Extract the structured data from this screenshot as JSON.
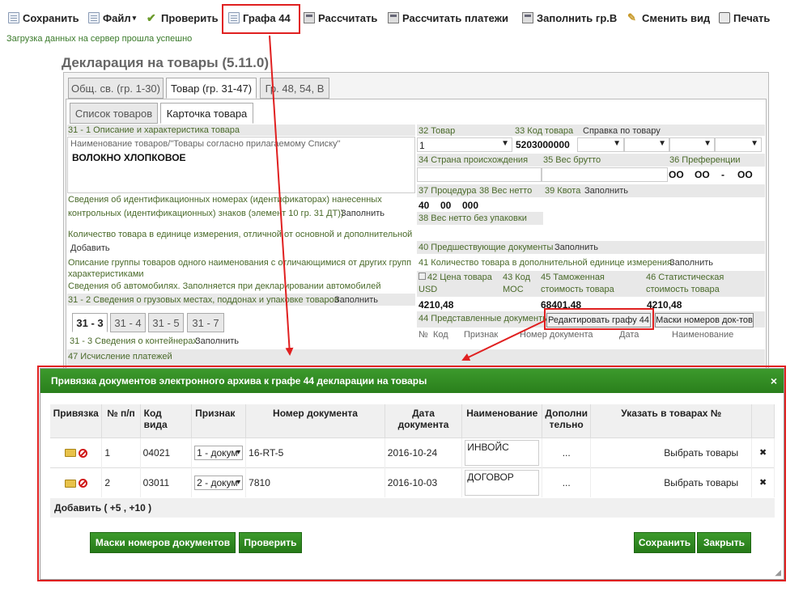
{
  "toolbar": {
    "save": "Сохранить",
    "file": "Файл",
    "check": "Проверить",
    "graph44": "Графа 44",
    "calculate": "Рассчитать",
    "calc_payments": "Рассчитать платежи",
    "fill_b": "Заполнить гр.В",
    "change_view": "Сменить вид",
    "print": "Печать"
  },
  "status_message": "Загрузка данных на сервер прошла успешно",
  "declaration_title": "Декларация на товары (5.11.0)",
  "tabs": [
    "Общ. св. (гр. 1-30)",
    "Товар (гр. 31-47)",
    "Гр. 48, 54, В"
  ],
  "subtabs": [
    "Список товаров",
    "Карточка товара"
  ],
  "left": {
    "f31_label": "31 - 1 Описание и характеристика товара",
    "f31_hint": "Наименование товаров/\"Товары согласно прилагаемому Списку\"",
    "f31_value": "ВОЛОКНО ХЛОПКОВОЕ",
    "ident_line1": "Сведения об идентификационных номерах (идентификаторах) нанесенных",
    "ident_line2": "контрольных (идентификационных) знаков (элемент 10 гр. 31 ДТ))",
    "fill": "Заполнить",
    "qty_label": "Количество товара в единице измерения, отличной от основной и дополнительной",
    "add": "Добавить",
    "group_desc_line1": "Описание группы товаров одного наименования с отличающимися от других групп",
    "group_desc_line2": "характеристиками",
    "cars": "Сведения об автомобилях. Заполняется при декларировании автомобилей",
    "f31_2": "31 - 2 Сведения о грузовых местах, поддонах и упаковке товаров",
    "subtabs31": [
      "31 - 3",
      "31 - 4",
      "31 - 5",
      "31 - 7"
    ],
    "containers": "31 - 3 Сведения о контейнерах",
    "f47": "47 Исчисление платежей"
  },
  "right": {
    "f32": "32 Товар",
    "f32_value": "1",
    "f33": "33 Код товара",
    "f33_value": "5203000000",
    "reference": "Справка по товару",
    "f34": "34 Страна происхождения",
    "f35": "35 Вес брутто",
    "f36": "36 Преференции",
    "f36_values": [
      "ОО",
      "ОО",
      "-",
      "ОО"
    ],
    "f37": "37 Процедура",
    "f37_values": [
      "40",
      "00",
      "000"
    ],
    "f38": "38 Вес нетто",
    "f39": "39 Квота",
    "f38b": "38 Вес нетто без упаковки",
    "f40": "40 Предшествующие документы",
    "f41": "41 Количество товара в дополнительной единице измерения",
    "f42": "42 Цена товара",
    "f42_currency": "USD",
    "f42_value": "4210,48",
    "f43": "43 Код",
    "f43b": "МОС",
    "f45": "45 Таможенная",
    "f45b": "стоимость товара",
    "f45_value": "68401,48",
    "f46": "46 Статистическая",
    "f46b": "стоимость товара",
    "f46_value": "4210,48",
    "f44": "44 Представленные документы",
    "edit44": "Редактировать графу 44",
    "masks": "Маски номеров док-тов",
    "cols": [
      "№",
      "Код",
      "Признак",
      "Номер документа",
      "Дата",
      "Наименование"
    ]
  },
  "modal": {
    "title": "Привязка документов электронного архива к графе 44 декларации на товары",
    "close": "×",
    "headers": [
      "Привязка",
      "№ п/п",
      "Код вида",
      "Признак",
      "Номер документа",
      "Дата документа",
      "Наименование",
      "Дополнительно",
      "Указать в товарах №"
    ],
    "rows": [
      {
        "num": "1",
        "code": "04021",
        "sign": "1 - докум",
        "doc": "16-RT-5",
        "date": "2016-10-24",
        "name": "ИНВОЙС",
        "extra": "...",
        "goods": "Выбрать товары",
        "remove": "✖"
      },
      {
        "num": "2",
        "code": "03011",
        "sign": "2 - докум",
        "doc": "7810",
        "date": "2016-10-03",
        "name": "ДОГОВОР",
        "extra": "...",
        "goods": "Выбрать товары",
        "remove": "✖"
      }
    ],
    "add": "Добавить ( +5 , +10 )",
    "btn_masks": "Маски номеров документов",
    "btn_check": "Проверить",
    "btn_save": "Сохранить",
    "btn_close": "Закрыть"
  },
  "colors": {
    "accent_green": "#2a7f1c",
    "highlight_red": "#e02020"
  }
}
